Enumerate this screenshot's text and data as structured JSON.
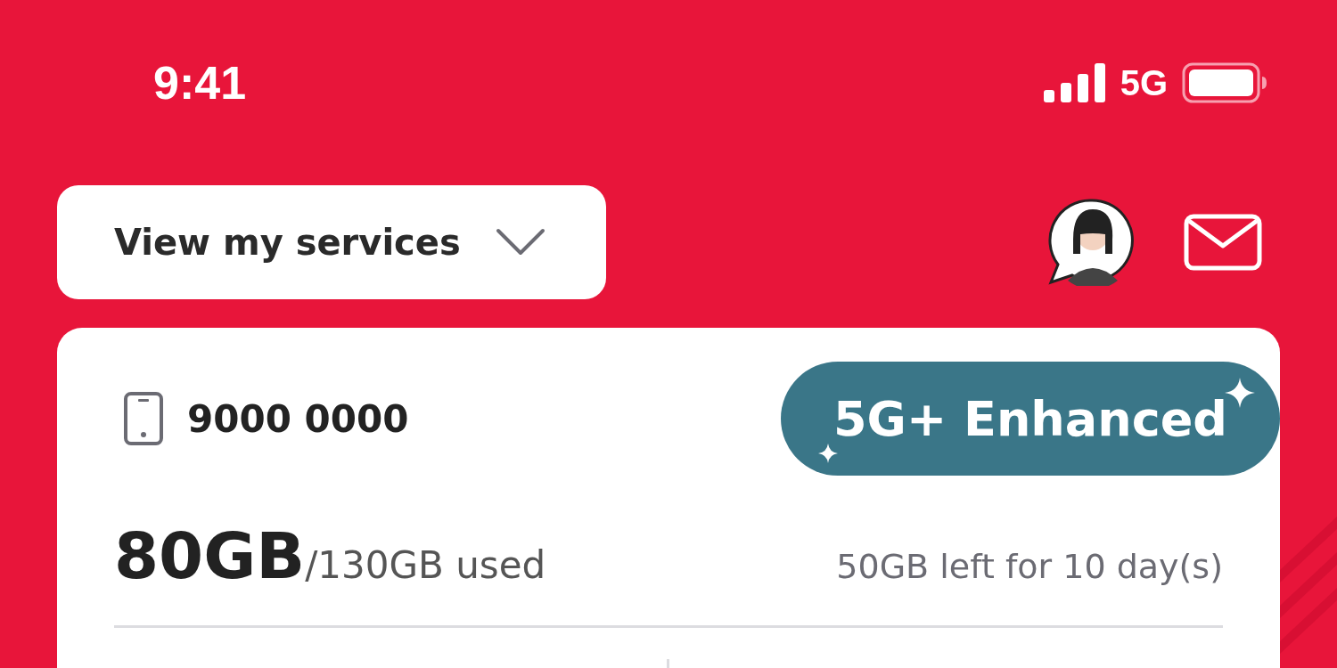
{
  "status_bar": {
    "time": "9:41",
    "network": "5G"
  },
  "header": {
    "services_button": {
      "label": "View my services"
    }
  },
  "line_card": {
    "phone_number": "9000 0000",
    "plan_badge": "5G+ Enhanced",
    "usage": {
      "used": "80GB",
      "total": "/130GB used",
      "remaining": "50GB left for 10 day(s)"
    }
  }
}
